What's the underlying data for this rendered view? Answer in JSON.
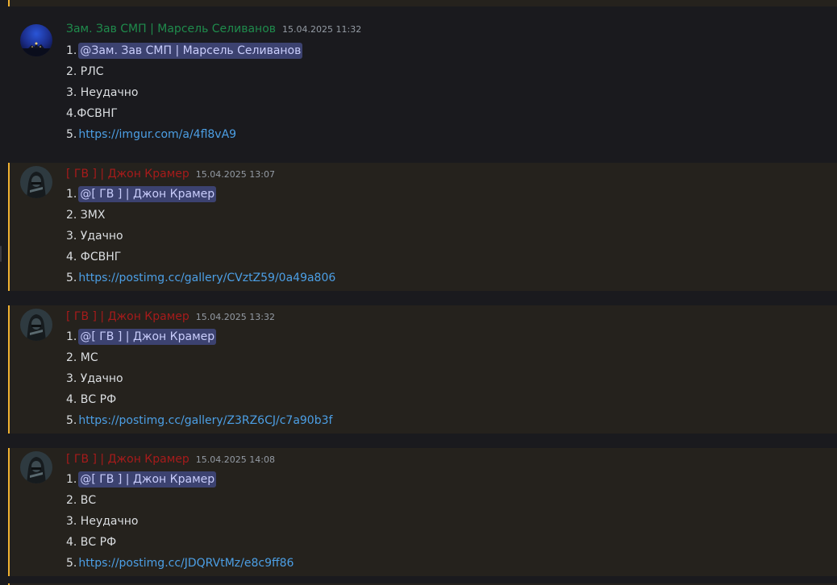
{
  "colors": {
    "highlight_bg": "#25221d",
    "highlight_border": "#f0b232",
    "author_green": "#1f8b4c",
    "author_red": "#a61b1b",
    "mention_bg": "#3c4270",
    "link": "#4c9fe5"
  },
  "messages": [
    {
      "author": "Зам. Зав СМП | Марсель Селиванов",
      "author_color": "green",
      "timestamp": "15.04.2025 11:32",
      "highlighted": false,
      "avatar": "night-city-avatar",
      "lines": {
        "n1": "1.",
        "mention": "@Зам. Зав СМП | Марсель Селиванов",
        "l2": "2. РЛС",
        "l3": "3. Неудачно",
        "l4": "4.ФСВНГ",
        "n5": "5.",
        "link": "https://imgur.com/a/4fl8vA9"
      }
    },
    {
      "author": "[ ГВ ] | Джон Крамер",
      "author_color": "red",
      "timestamp": "15.04.2025 13:07",
      "highlighted": true,
      "avatar": "hooded-figure-avatar",
      "lines": {
        "n1": "1.",
        "mention": "@[ ГВ ] | Джон Крамер",
        "l2": "2. ЗМХ",
        "l3": "3. Удачно",
        "l4": "4. ФСВНГ",
        "n5": "5.",
        "link": "https://postimg.cc/gallery/CVztZ59/0a49a806"
      }
    },
    {
      "author": "[ ГВ ] | Джон Крамер",
      "author_color": "red",
      "timestamp": "15.04.2025 13:32",
      "highlighted": true,
      "avatar": "hooded-figure-avatar",
      "lines": {
        "n1": "1.",
        "mention": "@[ ГВ ] | Джон Крамер",
        "l2": "2. МС",
        "l3": "3. Удачно",
        "l4": "4. ВС РФ",
        "n5": "5.",
        "link": "https://postimg.cc/gallery/Z3RZ6CJ/c7a90b3f"
      }
    },
    {
      "author": "[ ГВ ] | Джон Крамер",
      "author_color": "red",
      "timestamp": "15.04.2025 14:08",
      "highlighted": true,
      "avatar": "hooded-figure-avatar",
      "lines": {
        "n1": "1.",
        "mention": "@[ ГВ ] | Джон Крамер",
        "l2": "2. ВС",
        "l3": "3. Неудачно",
        "l4": "4. ВС РФ",
        "n5": "5.",
        "link": "https://postimg.cc/JDQRVtMz/e8c9ff86"
      }
    }
  ]
}
